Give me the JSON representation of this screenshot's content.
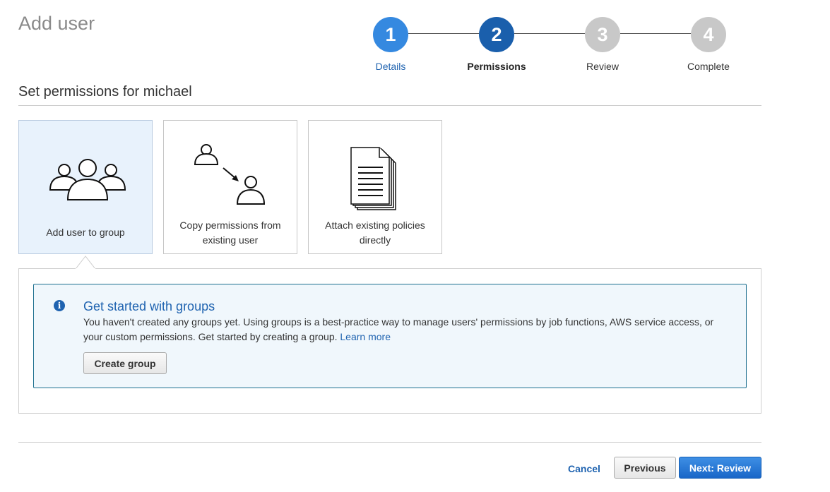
{
  "page": {
    "title": "Add user"
  },
  "stepper": {
    "steps": [
      {
        "number": "1",
        "label": "Details",
        "state": "done",
        "color": "#3589e0"
      },
      {
        "number": "2",
        "label": "Permissions",
        "state": "active",
        "color": "#1a5fac"
      },
      {
        "number": "3",
        "label": "Review",
        "state": "pending",
        "color": "#c8c8c8"
      },
      {
        "number": "4",
        "label": "Complete",
        "state": "pending",
        "color": "#c8c8c8"
      }
    ]
  },
  "section": {
    "title": "Set permissions for michael"
  },
  "options": [
    {
      "label": "Add user to group",
      "icon": "group-icon",
      "selected": true
    },
    {
      "label_line1": "Copy permissions from",
      "label_line2": "existing user",
      "icon": "copy-user-icon",
      "selected": false
    },
    {
      "label_line1": "Attach existing policies",
      "label_line2": "directly",
      "icon": "document-icon",
      "selected": false
    }
  ],
  "info": {
    "icon": "info-icon",
    "title": "Get started with groups",
    "text_line1": "You haven't created any groups yet. Using groups is a best-practice way to manage users' permissions by job functions, AWS service access, or",
    "text_line2": "your custom permissions. Get started by creating a group.",
    "link": "Learn more",
    "button": "Create group"
  },
  "footer": {
    "cancel": "Cancel",
    "previous": "Previous",
    "next": "Next: Review"
  },
  "colors": {
    "accent": "#1f63b0",
    "primary_button": "#1966c8",
    "selected_card": "#e8f2fc",
    "info_border": "#1d6f8f"
  }
}
